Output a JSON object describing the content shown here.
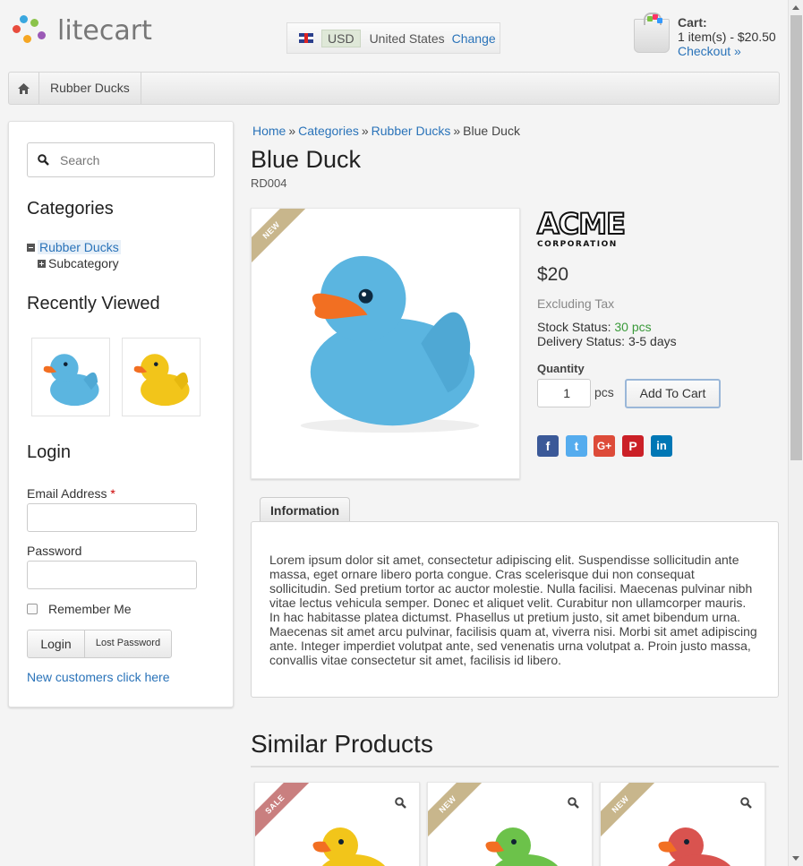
{
  "brand": {
    "name": "litecart"
  },
  "region": {
    "currency": "USD",
    "country": "United States",
    "change_label": "Change"
  },
  "cart": {
    "title": "Cart:",
    "summary": "1 item(s) - $20.50",
    "checkout_label": "Checkout »"
  },
  "nav": {
    "items": [
      {
        "label": "Rubber Ducks"
      }
    ]
  },
  "sidebar": {
    "search": {
      "placeholder": "Search"
    },
    "categories": {
      "title": "Categories",
      "items": [
        {
          "label": "Rubber Ducks"
        },
        {
          "label": "Subcategory"
        }
      ]
    },
    "recently_viewed": {
      "title": "Recently Viewed"
    },
    "login": {
      "title": "Login",
      "email_label": "Email Address",
      "required_mark": "*",
      "password_label": "Password",
      "remember_label": "Remember Me",
      "login_button": "Login",
      "lost_password_button": "Lost Password",
      "new_customers_link": "New customers click here"
    }
  },
  "breadcrumb": {
    "items": [
      "Home",
      "Categories",
      "Rubber Ducks",
      "Blue Duck"
    ],
    "separator": "»"
  },
  "product": {
    "name": "Blue Duck",
    "sku": "RD004",
    "badge": "NEW",
    "manufacturer_logo": {
      "line1": "ACME",
      "line2": "CORPORATION"
    },
    "price": "$20",
    "tax_note": "Excluding Tax",
    "stock_label": "Stock Status:",
    "stock_value": "30 pcs",
    "delivery_label": "Delivery Status:",
    "delivery_value": "3-5 days",
    "quantity_label": "Quantity",
    "quantity_value": "1",
    "quantity_unit": "pcs",
    "add_to_cart": "Add To Cart",
    "share": [
      {
        "name": "facebook",
        "glyph": "f",
        "color": "#3b5998"
      },
      {
        "name": "twitter",
        "glyph": "t",
        "color": "#55acee"
      },
      {
        "name": "google-plus",
        "glyph": "G+",
        "color": "#dd4b39"
      },
      {
        "name": "pinterest",
        "glyph": "P",
        "color": "#cb2027"
      },
      {
        "name": "linkedin",
        "glyph": "in",
        "color": "#0077b5"
      }
    ]
  },
  "tabs": [
    {
      "label": "Information"
    }
  ],
  "description": "Lorem ipsum dolor sit amet, consectetur adipiscing elit. Suspendisse sollicitudin ante massa, eget ornare libero porta congue. Cras scelerisque dui non consequat sollicitudin. Sed pretium tortor ac auctor molestie. Nulla facilisi. Maecenas pulvinar nibh vitae lectus vehicula semper. Donec et aliquet velit. Curabitur non ullamcorper mauris. In hac habitasse platea dictumst. Phasellus ut pretium justo, sit amet bibendum urna. Maecenas sit amet arcu pulvinar, facilisis quam at, viverra nisi. Morbi sit amet adipiscing ante. Integer imperdiet volutpat ante, sed venenatis urna volutpat a. Proin justo massa, convallis vitae consectetur sit amet, facilisis id libero.",
  "similar": {
    "title": "Similar Products",
    "items": [
      {
        "badge": "SALE",
        "duck_color": "#f2c51a"
      },
      {
        "badge": "NEW",
        "duck_color": "#6cc24a"
      },
      {
        "badge": "NEW",
        "duck_color": "#d9534f"
      }
    ]
  },
  "colors": {
    "link": "#2a73b9",
    "in_stock": "#3a9a3a",
    "ribbon_new": "#c8b68c",
    "ribbon_sale": "#c97f7f",
    "duck_blue": "#5bb5e0",
    "duck_yellow": "#f2c51a"
  }
}
